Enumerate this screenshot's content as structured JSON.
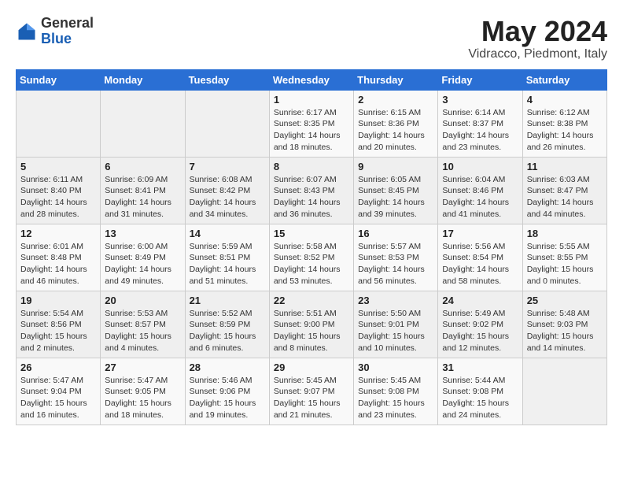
{
  "header": {
    "logo_general": "General",
    "logo_blue": "Blue",
    "month_year": "May 2024",
    "location": "Vidracco, Piedmont, Italy"
  },
  "weekdays": [
    "Sunday",
    "Monday",
    "Tuesday",
    "Wednesday",
    "Thursday",
    "Friday",
    "Saturday"
  ],
  "weeks": [
    [
      {
        "day": "",
        "info": ""
      },
      {
        "day": "",
        "info": ""
      },
      {
        "day": "",
        "info": ""
      },
      {
        "day": "1",
        "info": "Sunrise: 6:17 AM\nSunset: 8:35 PM\nDaylight: 14 hours\nand 18 minutes."
      },
      {
        "day": "2",
        "info": "Sunrise: 6:15 AM\nSunset: 8:36 PM\nDaylight: 14 hours\nand 20 minutes."
      },
      {
        "day": "3",
        "info": "Sunrise: 6:14 AM\nSunset: 8:37 PM\nDaylight: 14 hours\nand 23 minutes."
      },
      {
        "day": "4",
        "info": "Sunrise: 6:12 AM\nSunset: 8:38 PM\nDaylight: 14 hours\nand 26 minutes."
      }
    ],
    [
      {
        "day": "5",
        "info": "Sunrise: 6:11 AM\nSunset: 8:40 PM\nDaylight: 14 hours\nand 28 minutes."
      },
      {
        "day": "6",
        "info": "Sunrise: 6:09 AM\nSunset: 8:41 PM\nDaylight: 14 hours\nand 31 minutes."
      },
      {
        "day": "7",
        "info": "Sunrise: 6:08 AM\nSunset: 8:42 PM\nDaylight: 14 hours\nand 34 minutes."
      },
      {
        "day": "8",
        "info": "Sunrise: 6:07 AM\nSunset: 8:43 PM\nDaylight: 14 hours\nand 36 minutes."
      },
      {
        "day": "9",
        "info": "Sunrise: 6:05 AM\nSunset: 8:45 PM\nDaylight: 14 hours\nand 39 minutes."
      },
      {
        "day": "10",
        "info": "Sunrise: 6:04 AM\nSunset: 8:46 PM\nDaylight: 14 hours\nand 41 minutes."
      },
      {
        "day": "11",
        "info": "Sunrise: 6:03 AM\nSunset: 8:47 PM\nDaylight: 14 hours\nand 44 minutes."
      }
    ],
    [
      {
        "day": "12",
        "info": "Sunrise: 6:01 AM\nSunset: 8:48 PM\nDaylight: 14 hours\nand 46 minutes."
      },
      {
        "day": "13",
        "info": "Sunrise: 6:00 AM\nSunset: 8:49 PM\nDaylight: 14 hours\nand 49 minutes."
      },
      {
        "day": "14",
        "info": "Sunrise: 5:59 AM\nSunset: 8:51 PM\nDaylight: 14 hours\nand 51 minutes."
      },
      {
        "day": "15",
        "info": "Sunrise: 5:58 AM\nSunset: 8:52 PM\nDaylight: 14 hours\nand 53 minutes."
      },
      {
        "day": "16",
        "info": "Sunrise: 5:57 AM\nSunset: 8:53 PM\nDaylight: 14 hours\nand 56 minutes."
      },
      {
        "day": "17",
        "info": "Sunrise: 5:56 AM\nSunset: 8:54 PM\nDaylight: 14 hours\nand 58 minutes."
      },
      {
        "day": "18",
        "info": "Sunrise: 5:55 AM\nSunset: 8:55 PM\nDaylight: 15 hours\nand 0 minutes."
      }
    ],
    [
      {
        "day": "19",
        "info": "Sunrise: 5:54 AM\nSunset: 8:56 PM\nDaylight: 15 hours\nand 2 minutes."
      },
      {
        "day": "20",
        "info": "Sunrise: 5:53 AM\nSunset: 8:57 PM\nDaylight: 15 hours\nand 4 minutes."
      },
      {
        "day": "21",
        "info": "Sunrise: 5:52 AM\nSunset: 8:59 PM\nDaylight: 15 hours\nand 6 minutes."
      },
      {
        "day": "22",
        "info": "Sunrise: 5:51 AM\nSunset: 9:00 PM\nDaylight: 15 hours\nand 8 minutes."
      },
      {
        "day": "23",
        "info": "Sunrise: 5:50 AM\nSunset: 9:01 PM\nDaylight: 15 hours\nand 10 minutes."
      },
      {
        "day": "24",
        "info": "Sunrise: 5:49 AM\nSunset: 9:02 PM\nDaylight: 15 hours\nand 12 minutes."
      },
      {
        "day": "25",
        "info": "Sunrise: 5:48 AM\nSunset: 9:03 PM\nDaylight: 15 hours\nand 14 minutes."
      }
    ],
    [
      {
        "day": "26",
        "info": "Sunrise: 5:47 AM\nSunset: 9:04 PM\nDaylight: 15 hours\nand 16 minutes."
      },
      {
        "day": "27",
        "info": "Sunrise: 5:47 AM\nSunset: 9:05 PM\nDaylight: 15 hours\nand 18 minutes."
      },
      {
        "day": "28",
        "info": "Sunrise: 5:46 AM\nSunset: 9:06 PM\nDaylight: 15 hours\nand 19 minutes."
      },
      {
        "day": "29",
        "info": "Sunrise: 5:45 AM\nSunset: 9:07 PM\nDaylight: 15 hours\nand 21 minutes."
      },
      {
        "day": "30",
        "info": "Sunrise: 5:45 AM\nSunset: 9:08 PM\nDaylight: 15 hours\nand 23 minutes."
      },
      {
        "day": "31",
        "info": "Sunrise: 5:44 AM\nSunset: 9:08 PM\nDaylight: 15 hours\nand 24 minutes."
      },
      {
        "day": "",
        "info": ""
      }
    ]
  ]
}
